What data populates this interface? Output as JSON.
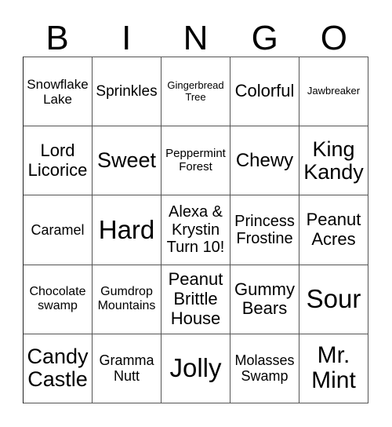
{
  "header": {
    "letters": [
      "B",
      "I",
      "N",
      "G",
      "O"
    ]
  },
  "grid": {
    "rows": [
      [
        "Snowflake Lake",
        "Sprinkles",
        "Gingerbread Tree",
        "Colorful",
        "Jawbreaker"
      ],
      [
        "Lord Licorice",
        "Sweet",
        "Peppermint Forest",
        "Chewy",
        "King Kandy"
      ],
      [
        "Caramel",
        "Hard",
        "Alexa & Krystin Turn 10!",
        "Princess Frostine",
        "Peanut Acres"
      ],
      [
        "Chocolate swamp",
        "Gumdrop Mountains",
        "Peanut Brittle House",
        "Gummy Bears",
        "Sour"
      ],
      [
        "Candy Castle",
        "Gramma Nutt",
        "Jolly",
        "Molasses Swamp",
        "Mr. Mint"
      ]
    ]
  }
}
